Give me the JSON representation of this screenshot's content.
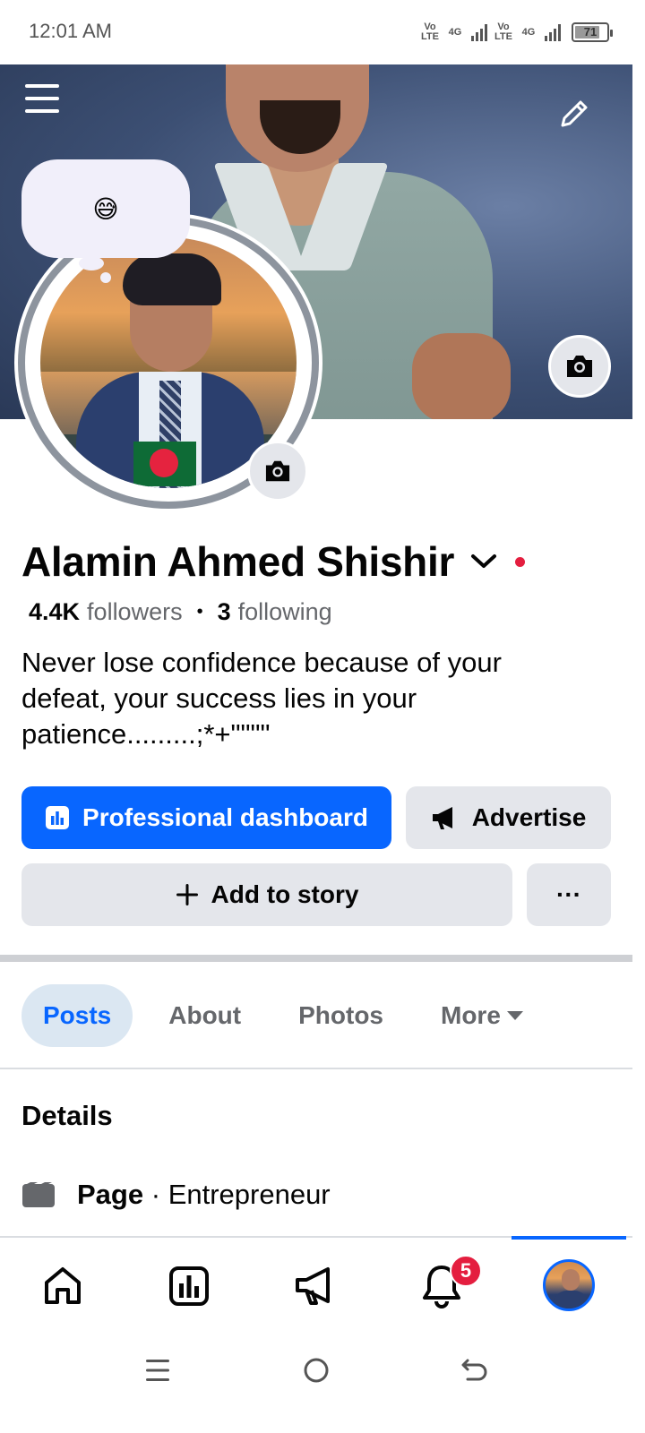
{
  "status_bar": {
    "time": "12:01 AM",
    "sim1_label": "Vo LTE",
    "sim1_net": "4G",
    "sim2_label": "Vo LTE",
    "sim2_net": "4G",
    "battery": "71"
  },
  "profile": {
    "thought_emoji": "😅",
    "name": "Alamin Ahmed Shishir",
    "followers_count": "4.4K",
    "followers_label": "followers",
    "following_count": "3",
    "following_label": "following",
    "bio": "Never lose confidence because of your defeat, your success lies in your patience.........;*+\"\"\"\""
  },
  "actions": {
    "dashboard_label": "Professional dashboard",
    "advertise_label": "Advertise",
    "add_story_label": "Add to story",
    "more_label": "···"
  },
  "tabs": [
    {
      "label": "Posts",
      "active": true
    },
    {
      "label": "About",
      "active": false
    },
    {
      "label": "Photos",
      "active": false
    },
    {
      "label": "More",
      "active": false
    }
  ],
  "details": {
    "title": "Details",
    "page_label": "Page",
    "page_separator": "·",
    "page_category": "Entrepreneur"
  },
  "bottom_nav": {
    "notifications_badge": "5",
    "active_item": "profile"
  },
  "colors": {
    "accent": "#0866ff",
    "badge": "#e41e3f",
    "secondary_button": "#e4e6eb",
    "active_tab_bg": "#dbe7f2"
  }
}
